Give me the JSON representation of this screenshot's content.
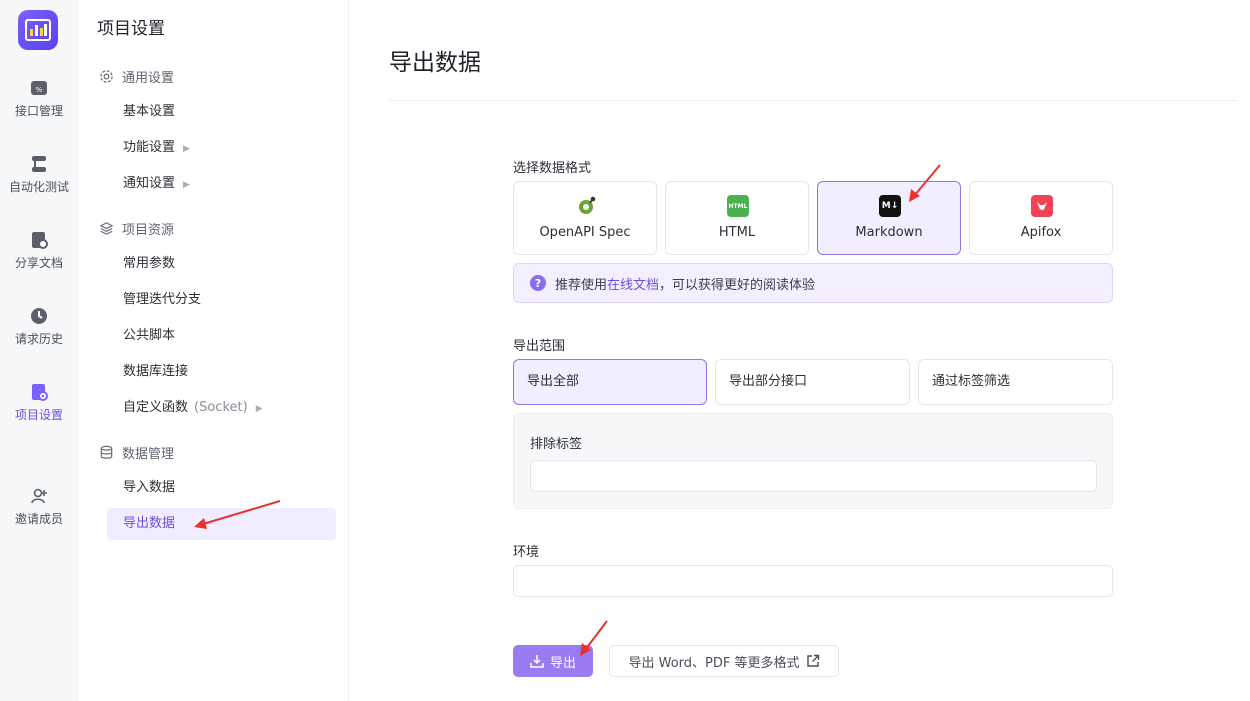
{
  "rail": {
    "items": [
      {
        "label": "接口管理",
        "icon": "api-icon"
      },
      {
        "label": "自动化测试",
        "icon": "automation-icon"
      },
      {
        "label": "分享文档",
        "icon": "share-doc-icon"
      },
      {
        "label": "请求历史",
        "icon": "history-icon"
      },
      {
        "label": "项目设置",
        "icon": "settings-doc-icon"
      },
      {
        "label": "邀请成员",
        "icon": "invite-user-icon"
      }
    ]
  },
  "sidebar": {
    "title": "项目设置",
    "groups": [
      {
        "label": "通用设置",
        "icon": "gear-icon"
      },
      {
        "label": "项目资源",
        "icon": "layers-icon"
      },
      {
        "label": "数据管理",
        "icon": "database-icon"
      }
    ],
    "items": [
      {
        "label": "基本设置"
      },
      {
        "label": "功能设置"
      },
      {
        "label": "通知设置"
      },
      {
        "label": "常用参数"
      },
      {
        "label": "管理迭代分支"
      },
      {
        "label": "公共脚本"
      },
      {
        "label": "数据库连接"
      },
      {
        "label": "自定义函数",
        "suffix": "(Socket)"
      },
      {
        "label": "导入数据"
      },
      {
        "label": "导出数据"
      }
    ]
  },
  "main": {
    "title": "导出数据",
    "format_label": "选择数据格式",
    "formats": [
      {
        "label": "OpenAPI Spec",
        "icon": "openapi-icon"
      },
      {
        "label": "HTML",
        "icon": "html-icon",
        "badge": "HTML"
      },
      {
        "label": "Markdown",
        "icon": "markdown-icon",
        "badge": "M↓"
      },
      {
        "label": "Apifox",
        "icon": "apifox-icon"
      }
    ],
    "tip": {
      "prefix": "推荐使用",
      "link": "在线文档",
      "suffix": "，可以获得更好的阅读体验"
    },
    "scope_label": "导出范围",
    "scopes": [
      {
        "label": "导出全部"
      },
      {
        "label": "导出部分接口"
      },
      {
        "label": "通过标签筛选"
      }
    ],
    "exclude_label": "排除标签",
    "exclude_value": "",
    "env_label": "环境",
    "env_value": "",
    "export_button": "导出",
    "more_formats_button": "导出 Word、PDF 等更多格式"
  },
  "colors": {
    "accent": "#6d4fe0",
    "accent_bg": "#f2eeff",
    "export_button": "#9b7bf2",
    "annotation_arrow": "#e8322f"
  }
}
